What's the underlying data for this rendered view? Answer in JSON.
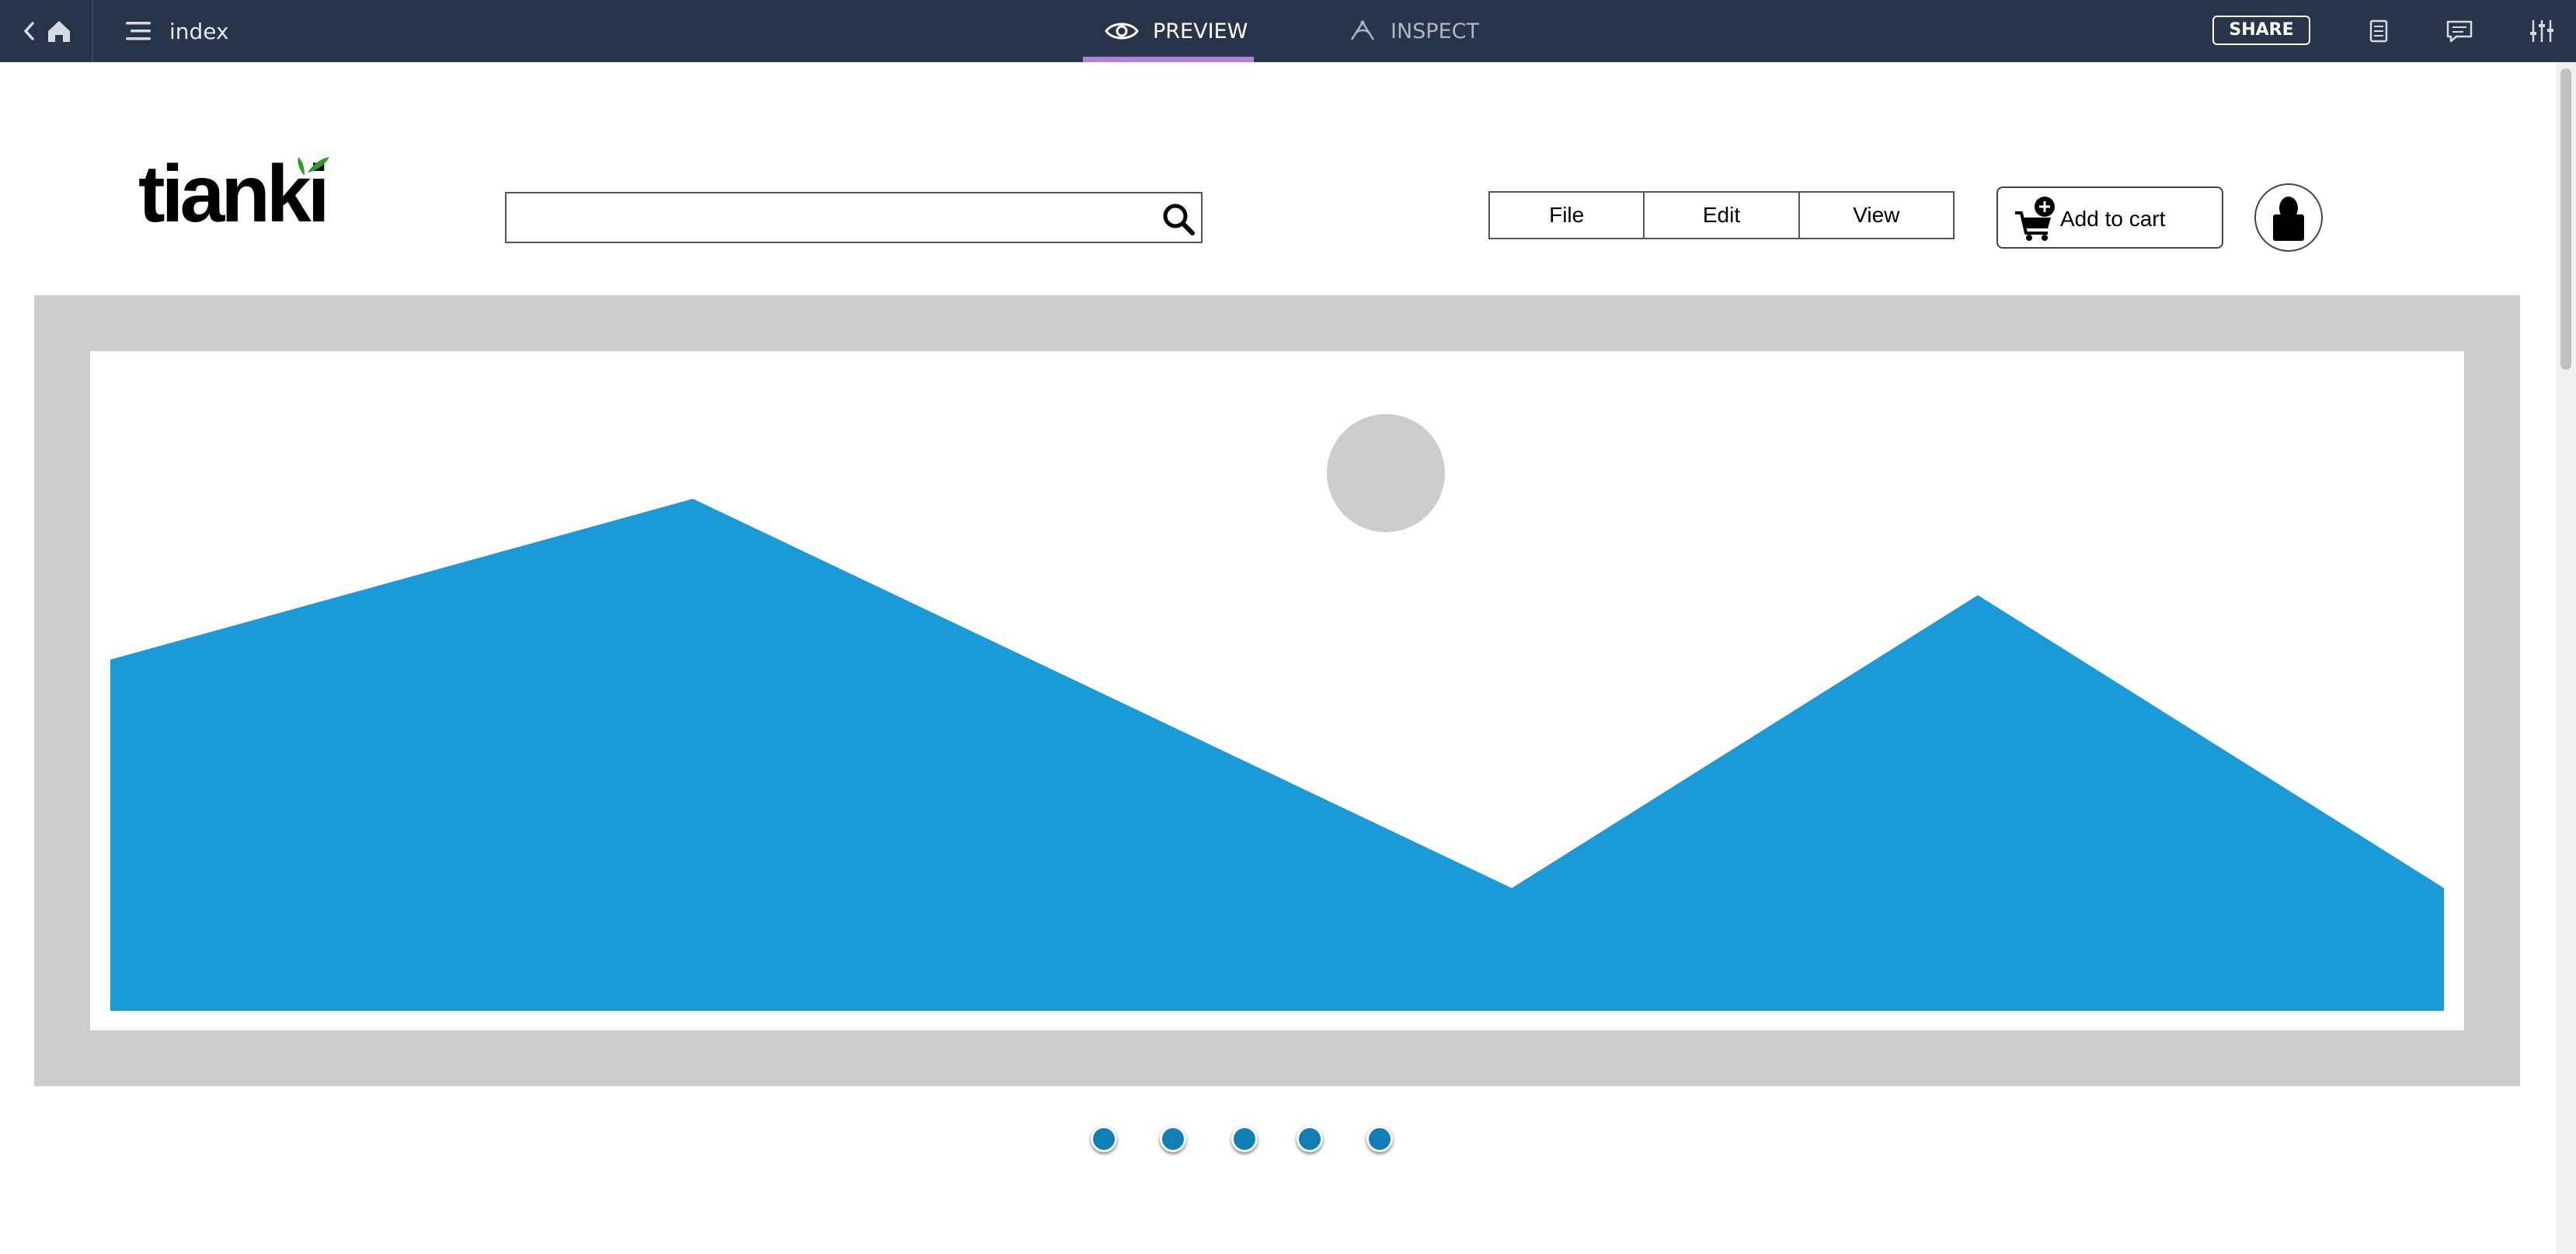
{
  "toolbar": {
    "page_name": "index",
    "tabs": [
      {
        "label": "PREVIEW",
        "active": true
      },
      {
        "label": "INSPECT",
        "active": false
      }
    ],
    "share_label": "SHARE",
    "icons": [
      "back-chevron-icon",
      "home-icon",
      "pages-menu-icon",
      "eye-icon",
      "inspect-icon",
      "notes-icon",
      "comment-icon",
      "settings-sliders-icon"
    ],
    "colors": {
      "background": "#28344a",
      "active_tab_indicator": "#b57fe0"
    }
  },
  "header": {
    "logo_text": "tianki",
    "search": {
      "value": "",
      "placeholder": ""
    },
    "menu": [
      "File",
      "Edit",
      "View"
    ],
    "cart_label": "Add to cart"
  },
  "carousel": {
    "slide_count": 5,
    "image_placeholder": {
      "sky_color": "#ffffff",
      "mountain_color": "#1a9ad6",
      "sun_color": "#cccccc",
      "frame_color": "#cccccc"
    },
    "dot_color": "#117fb5"
  }
}
